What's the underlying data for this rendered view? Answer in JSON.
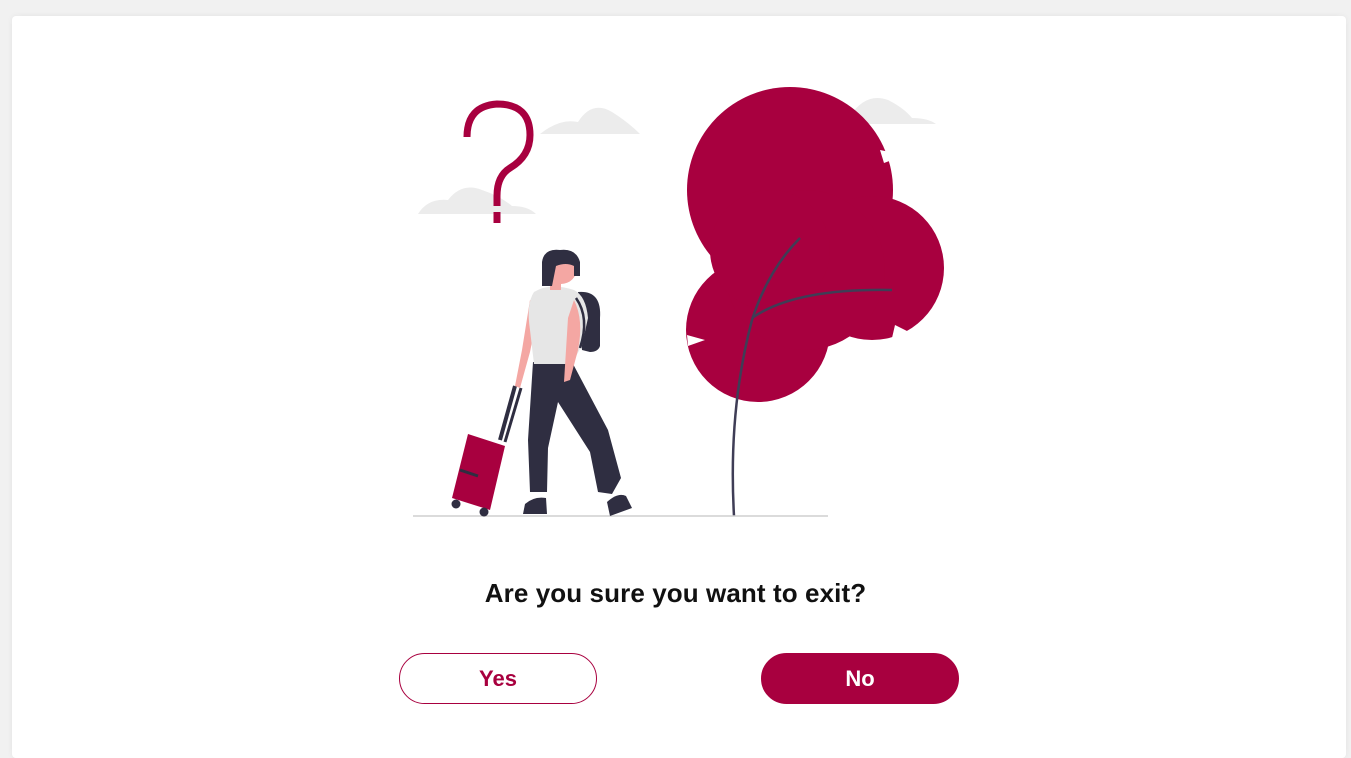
{
  "dialog": {
    "question": "Are you sure you want to exit?",
    "yes_label": "Yes",
    "no_label": "No"
  },
  "colors": {
    "accent": "#a8003f",
    "dark": "#2f2e41",
    "cloud": "#ececec",
    "shirt": "#e6e6e6",
    "skin": "#f4a7a3"
  },
  "illustration": {
    "icon": "traveler-with-suitcase-illustration"
  }
}
